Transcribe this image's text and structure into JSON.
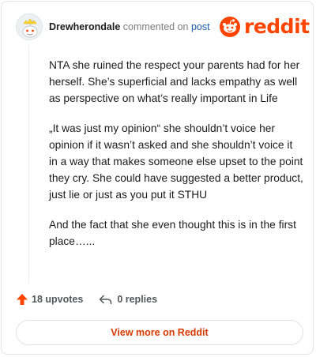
{
  "header": {
    "author": "Drewherondale",
    "action": "commented on",
    "link": "post",
    "brand": "reddit"
  },
  "comment": {
    "paragraphs": [
      "NTA she ruined the respect your parents had for her herself. She’s superficial and lacks empathy as well as perspective on what’s really important in Life",
      "„It was just my opinion“ she shouldn’t voice her opinion if it wasn’t asked and she shouldn’t voice it in a way that makes someone else upset to the point they cry. She could have suggested a better product, just lie or just as you put it STHU",
      "And the fact that she even thought this is in the first place…..."
    ]
  },
  "footer": {
    "upvotes": "18 upvotes",
    "replies": "0 replies"
  },
  "cta": {
    "label": "View more on Reddit"
  },
  "colors": {
    "brand": "#ff4500",
    "link": "#1c5aa6",
    "cta": "#d93a00"
  },
  "icons": [
    "avatar-snoo-icon",
    "reddit-logo-icon",
    "upvote-arrow-icon",
    "reply-arrow-icon"
  ]
}
